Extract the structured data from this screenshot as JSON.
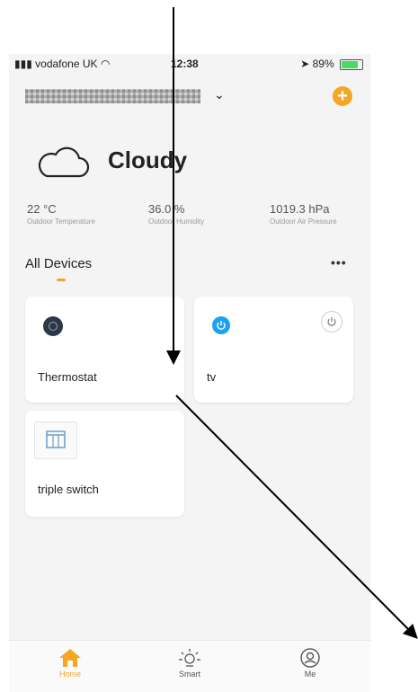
{
  "status_bar": {
    "carrier": "vodafone UK",
    "time": "12:38",
    "battery": "89%"
  },
  "header": {
    "add_label": "+"
  },
  "weather": {
    "condition": "Cloudy",
    "stats": [
      {
        "value": "22 °C",
        "label": "Outdoor Temperature"
      },
      {
        "value": "36.0 %",
        "label": "Outdoor Humidity"
      },
      {
        "value": "1019.3 hPa",
        "label": "Outdoor Air Pressure"
      }
    ]
  },
  "devices": {
    "title": "All Devices",
    "more": "•••",
    "items": [
      {
        "name": "Thermostat"
      },
      {
        "name": "tv"
      },
      {
        "name": "triple switch"
      }
    ]
  },
  "tabbar": {
    "home": "Home",
    "smart": "Smart",
    "me": "Me"
  },
  "colors": {
    "accent": "#f5a623",
    "tv_blue": "#1da1f2",
    "background": "#f4f4f4"
  }
}
